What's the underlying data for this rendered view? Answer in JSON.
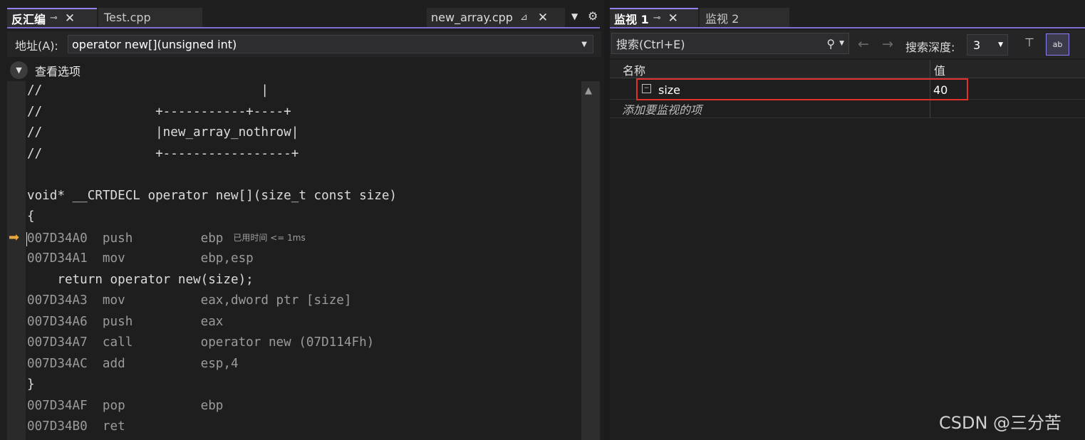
{
  "left": {
    "tabs": [
      {
        "label": "反汇编",
        "active": true
      },
      {
        "label": "Test.cpp",
        "active": false
      }
    ],
    "right_tab": {
      "label": "new_array.cpp"
    },
    "address": {
      "label": "地址(A):",
      "value": "operator new[](unsigned int)"
    },
    "view_options": "查看选项",
    "elapsed": "已用时间 <= 1ms",
    "code_lines": [
      {
        "text": "//                             |",
        "asm": false
      },
      {
        "text": "//               +-----------+----+",
        "asm": false
      },
      {
        "text": "//               |new_array_nothrow|",
        "asm": false
      },
      {
        "text": "//               +-----------------+",
        "asm": false
      },
      {
        "text": "",
        "asm": false
      },
      {
        "text": "void* __CRTDECL operator new[](size_t const size)",
        "asm": false
      },
      {
        "text": "{",
        "asm": false
      },
      {
        "text": "007D34A0  push         ebp",
        "asm": true
      },
      {
        "text": "007D34A1  mov          ebp,esp",
        "asm": true
      },
      {
        "text": "    return operator new(size);",
        "asm": false
      },
      {
        "text": "007D34A3  mov          eax,dword ptr [size]",
        "asm": true
      },
      {
        "text": "007D34A6  push         eax",
        "asm": true
      },
      {
        "text": "007D34A7  call         operator new (07D114Fh)",
        "asm": true
      },
      {
        "text": "007D34AC  add          esp,4",
        "asm": true
      },
      {
        "text": "}",
        "asm": false
      },
      {
        "text": "007D34AF  pop          ebp",
        "asm": true
      },
      {
        "text": "007D34B0  ret",
        "asm": true
      }
    ]
  },
  "watch": {
    "tabs": [
      {
        "label": "监视 1",
        "active": true
      },
      {
        "label": "监视 2",
        "active": false
      }
    ],
    "search_placeholder": "搜索(Ctrl+E)",
    "depth_label": "搜索深度:",
    "depth_value": "3",
    "columns": {
      "name": "名称",
      "value": "值"
    },
    "rows": [
      {
        "name": "size",
        "value": "40"
      }
    ],
    "add_prompt": "添加要监视的项"
  },
  "watermark": "CSDN @三分苦",
  "colors": {
    "accent": "#7b6fd6",
    "highlight_border": "#e0312b",
    "background": "#1e1e1e"
  },
  "icons": [
    "pin-icon",
    "close-icon",
    "settings-icon",
    "chevron-down-icon",
    "search-icon",
    "arrow-left-icon",
    "arrow-right-icon",
    "execution-arrow-icon",
    "variable-icon"
  ]
}
